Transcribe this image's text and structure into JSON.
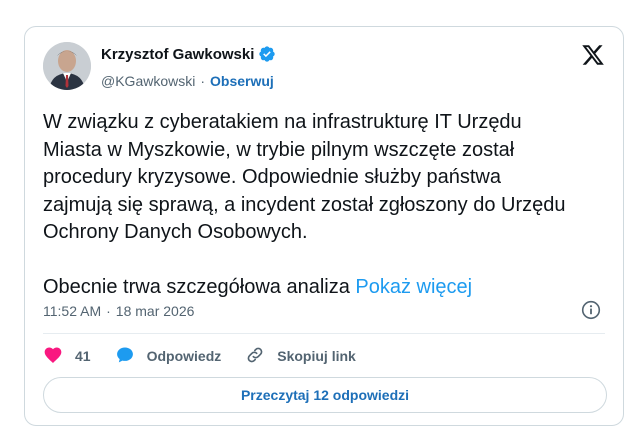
{
  "author": {
    "name": "Krzysztof Gawkowski",
    "handle": "@KGawkowski",
    "separator": "·",
    "follow_label": "Obserwuj"
  },
  "tweet": {
    "text": "W związku z cyberatakiem na infrastrukturę IT Urzędu\nMiasta w Myszkowie, w trybie pilnym wszczęte został\nprocedury kryzysowe. Odpowiednie służby państwa\nzajmują się sprawą, a incydent został zgłoszony do Urzędu\nOchrony Danych Osobowych.\n\nObecnie trwa szczegółowa analiza ",
    "show_more": "Pokaż więcej",
    "time": "11:52 AM",
    "date_separator": "·",
    "date": "18 mar 2026"
  },
  "actions": {
    "likes": "41",
    "reply_label": "Odpowiedz",
    "copy_link_label": "Skopiuj link"
  },
  "read_replies_label": "Przeczytaj 12 odpowiedzi",
  "colors": {
    "accent": "#1d9bf0",
    "like": "#f91880",
    "verified": "#1d9bf0"
  },
  "icons": [
    "verified-icon",
    "x-logo-icon",
    "info-icon",
    "heart-icon",
    "reply-icon",
    "link-icon"
  ]
}
